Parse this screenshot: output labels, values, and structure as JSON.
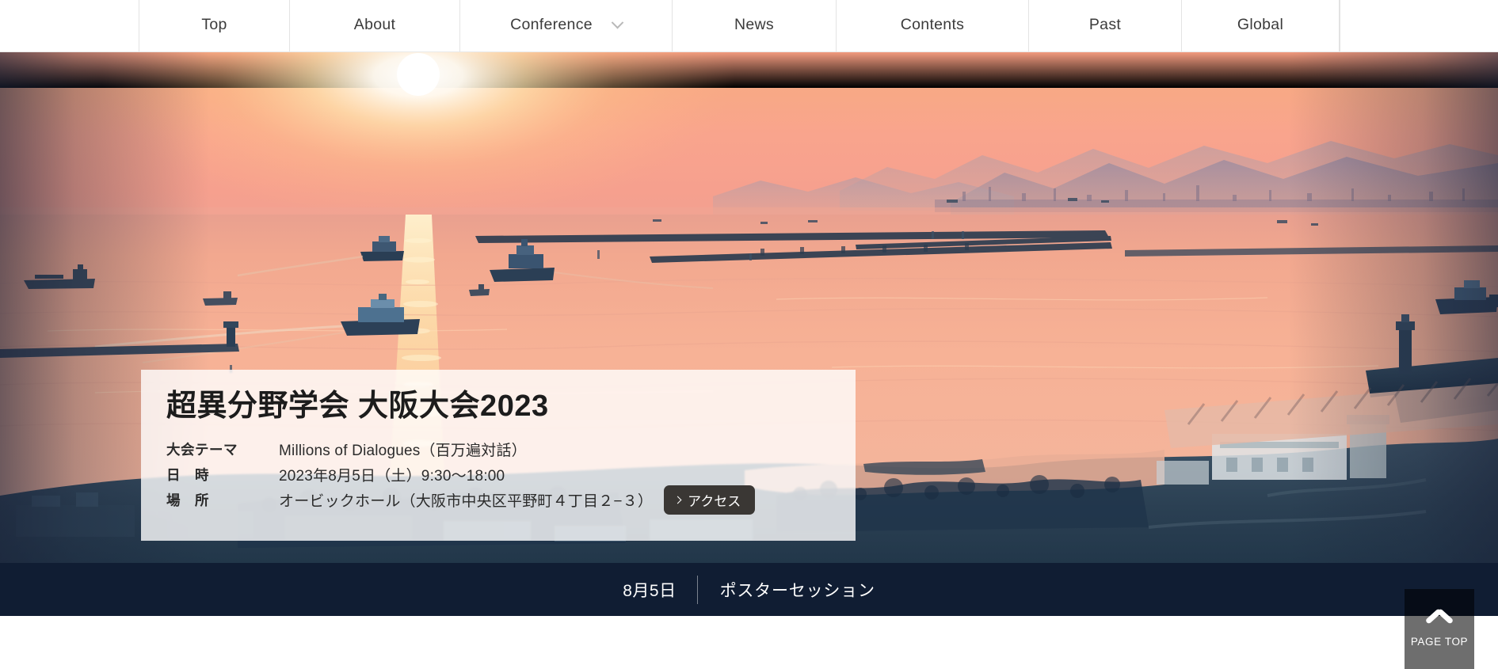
{
  "nav": {
    "items": [
      {
        "label": "Top",
        "has_dropdown": false,
        "width_class": "w-top"
      },
      {
        "label": "About",
        "has_dropdown": false,
        "width_class": "w-about"
      },
      {
        "label": "Conference",
        "has_dropdown": true,
        "width_class": "w-conf"
      },
      {
        "label": "News",
        "has_dropdown": false,
        "width_class": "w-news"
      },
      {
        "label": "Contents",
        "has_dropdown": false,
        "width_class": "w-contents"
      },
      {
        "label": "Past",
        "has_dropdown": false,
        "width_class": "w-past"
      },
      {
        "label": "Global",
        "has_dropdown": false,
        "width_class": "w-global"
      }
    ]
  },
  "hero": {
    "alt": "sunset-over-osaka-bay-photo",
    "colors": {
      "sky_top": "#f6a98c",
      "sky_sun": "#fff6e2",
      "sky_mid": "#f79a86",
      "sea_near": "#f6b49a",
      "land_dark": "#2b4356"
    }
  },
  "card": {
    "title": "超異分野学会 大阪大会2023",
    "rows": [
      {
        "label": "大会テーマ",
        "value": "Millions of Dialogues（百万遍対話）"
      },
      {
        "label": "日　時",
        "value": "2023年8月5日（土）9:30〜18:00"
      },
      {
        "label": "場　所",
        "value": "オービックホール（大阪市中央区平野町４丁目２−３）"
      }
    ],
    "access_button": {
      "label": "アクセス",
      "icon": "chevron-right-icon"
    }
  },
  "ticker": {
    "date": "8月5日",
    "text": "ポスターセッション"
  },
  "page_top": {
    "label": "PAGE TOP",
    "icon": "chevron-up-icon"
  },
  "theme": {
    "accent_dark": "#101d33",
    "button_dark": "#3a3734",
    "nav_text": "#3b3b3b",
    "page_top_bg": "#6e6e6e"
  }
}
